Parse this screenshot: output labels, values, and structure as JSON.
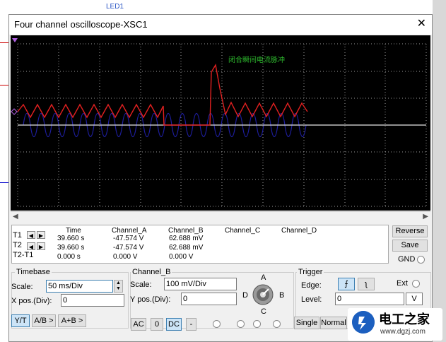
{
  "window": {
    "title": "Four channel oscilloscope-XSC1",
    "close_glyph": "✕"
  },
  "screen": {
    "annotation": "闭合瞬间电流脉冲",
    "colors": {
      "background": "#000000",
      "grid": "#9a9a9a",
      "channel_a": "#e02020",
      "channel_b": "#1e1ea0",
      "trace_b_line": "#e8e8e8",
      "annotation": "#2db82d"
    }
  },
  "readout": {
    "rows": [
      "T1",
      "T2",
      "T2-T1"
    ],
    "headers": [
      "Time",
      "Channel_A",
      "Channel_B",
      "Channel_C",
      "Channel_D"
    ],
    "time": [
      "39.660 s",
      "39.660 s",
      "0.000 s"
    ],
    "channel_a": [
      "-47.574 V",
      "-47.574 V",
      "0.000 V"
    ],
    "channel_b": [
      "62.688 mV",
      "62.688 mV",
      "0.000 V"
    ]
  },
  "side": {
    "reverse": "Reverse",
    "save": "Save",
    "gnd": "GND"
  },
  "timebase": {
    "title": "Timebase",
    "scale_label": "Scale:",
    "scale_value": "50 ms/Div",
    "xpos_label": "X pos.(Div):",
    "xpos_value": "0",
    "btn_yt": "Y/T",
    "btn_ab": "A/B >",
    "btn_apb": "A+B >"
  },
  "channel": {
    "title": "Channel_B",
    "scale_label": "Scale:",
    "scale_value": "100 mV/Div",
    "ypos_label": "Y pos.(Div):",
    "ypos_value": "0",
    "btn_ac": "AC",
    "btn_zero": "0",
    "btn_dc": "DC",
    "btn_minus": "-"
  },
  "knob": {
    "a": "A",
    "b": "B",
    "c": "C",
    "d": "D"
  },
  "trigger": {
    "title": "Trigger",
    "edge_label": "Edge:",
    "ext_label": "Ext",
    "level_label": "Level:",
    "level_value": "0",
    "level_unit": "V",
    "btn_single": "Single",
    "btn_normal": "Normal"
  },
  "watermark": {
    "title": "电工之家",
    "url": "www.dgzj.com"
  }
}
